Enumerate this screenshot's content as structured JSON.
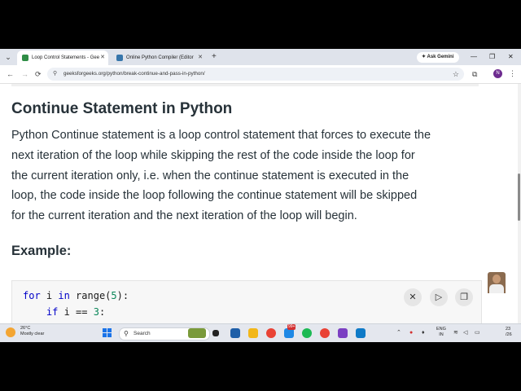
{
  "browser": {
    "tabs": [
      {
        "title": "Loop Control Statements - Gee",
        "active": true,
        "favicon_color": "#2f8d46"
      },
      {
        "title": "Online Python Compiler (Editor",
        "active": false,
        "favicon_color": "#3776ab"
      }
    ],
    "new_tab_glyph": "+",
    "ask_gemini": "Ask Gemini",
    "window_controls": {
      "minimize": "—",
      "maximize": "❐",
      "close": "✕"
    },
    "address": {
      "url": "geeksforgeeks.org/python/break-continue-and-pass-in-python/",
      "site_icon": "site-info-icon",
      "bookmark_icon": "star-icon"
    },
    "profile_initial": "N",
    "nav": {
      "back": "←",
      "forward": "→",
      "reload": "⟳",
      "menu": "⋮",
      "tab_menu": "⌄"
    }
  },
  "article": {
    "heading": "Continue Statement in Python",
    "paragraph_lines": [
      "Python Continue statement is a loop control statement that forces to execute the",
      "next iteration of the loop while skipping the rest of the code inside the loop for",
      "the current iteration only, i.e. when the continue statement is executed in the",
      "loop, the code inside the loop following the continue statement will be skipped",
      "for the current iteration and the next iteration of the loop will begin."
    ],
    "example_heading": "Example:",
    "code": {
      "line1": {
        "kw1": "for",
        "t1": " i ",
        "kw2": "in",
        "t2": " range(",
        "num": "5",
        "t3": "):"
      },
      "line2": {
        "indent": "    ",
        "kw": "if",
        "t1": " i == ",
        "num": "3",
        "t2": ":"
      }
    },
    "code_buttons": {
      "close": "✕",
      "run": "▷",
      "copy": "❐"
    }
  },
  "taskbar": {
    "weather_temp": "26°C",
    "weather_desc": "Mostly clear",
    "search_placeholder": "Search",
    "badge_count": "99+",
    "lang_line1": "ENG",
    "lang_line2": "IN",
    "clock_line1": "23",
    "clock_line2": "/26"
  }
}
